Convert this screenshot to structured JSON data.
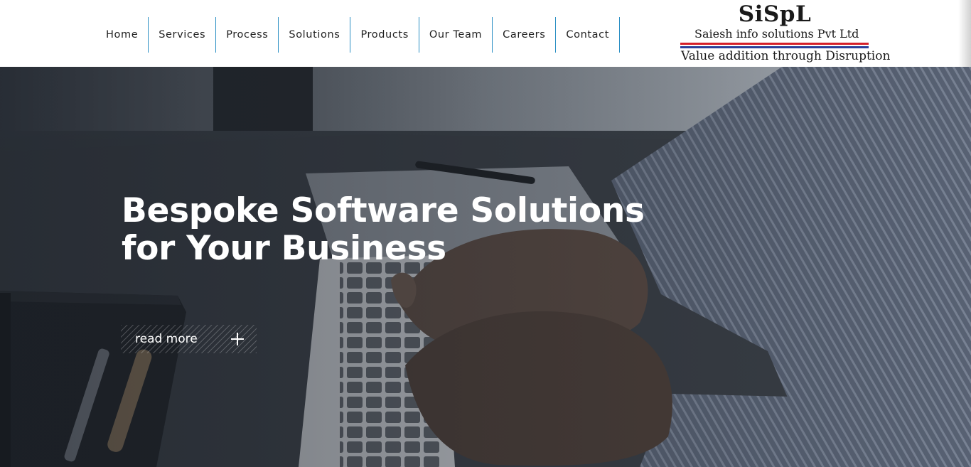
{
  "nav": {
    "items": [
      {
        "label": "Home"
      },
      {
        "label": "Services"
      },
      {
        "label": "Process"
      },
      {
        "label": "Solutions"
      },
      {
        "label": "Products"
      },
      {
        "label": "Our Team"
      },
      {
        "label": "Careers"
      },
      {
        "label": "Contact"
      }
    ],
    "divider_color": "#2b8fc4"
  },
  "logo": {
    "mark": "SiSpL",
    "company": "Saiesh info solutions Pvt Ltd",
    "tagline": "Value addition through Disruption",
    "colors": {
      "red": "#d6202a",
      "blue": "#2b3f9a"
    }
  },
  "hero": {
    "title": "Bespoke Software Solutions for Your Business",
    "button_label": "read more",
    "button_icon": "plus-icon"
  }
}
